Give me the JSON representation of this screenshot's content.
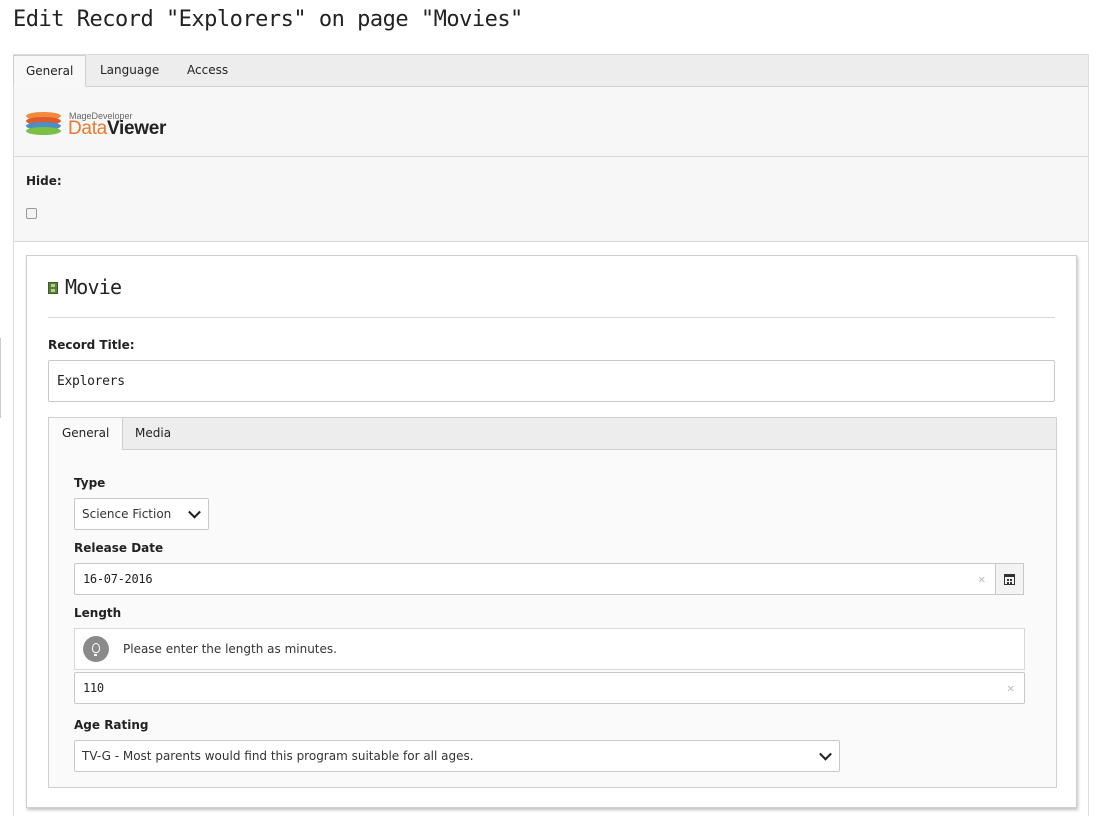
{
  "page": {
    "title": "Edit Record \"Explorers\" on page \"Movies\""
  },
  "top_tabs": [
    {
      "label": "General",
      "active": true
    },
    {
      "label": "Language",
      "active": false
    },
    {
      "label": "Access",
      "active": false
    }
  ],
  "logo": {
    "small_text": "MageDeveloper",
    "word1": "Data",
    "word2": "Viewer",
    "disc_colors": [
      "#f08a3c",
      "#e05a2a",
      "#4a8fc8",
      "#7bbf45"
    ]
  },
  "hide": {
    "label": "Hide:",
    "checked": false
  },
  "record": {
    "heading": "Movie",
    "heading_icon": "film-icon",
    "title_label": "Record Title:",
    "title_value": "Explorers"
  },
  "inner_tabs": [
    {
      "label": "General",
      "active": true
    },
    {
      "label": "Media",
      "active": false
    }
  ],
  "fields": {
    "type": {
      "label": "Type",
      "value": "Science Fiction"
    },
    "release_date": {
      "label": "Release Date",
      "value": "16-07-2016",
      "clear_icon": "clear-x-icon",
      "button_icon": "calendar-icon"
    },
    "length": {
      "label": "Length",
      "hint": "Please enter the length as minutes.",
      "hint_icon": "lightbulb-icon",
      "value": "110",
      "clear_icon": "clear-x-icon"
    },
    "age_rating": {
      "label": "Age Rating",
      "value": "TV-G - Most parents would find this program suitable for all ages."
    }
  },
  "colors": {
    "tabbar_bg": "#ededed",
    "panel_bg": "#f7f7f7",
    "logo_orange": "#e8792e"
  }
}
